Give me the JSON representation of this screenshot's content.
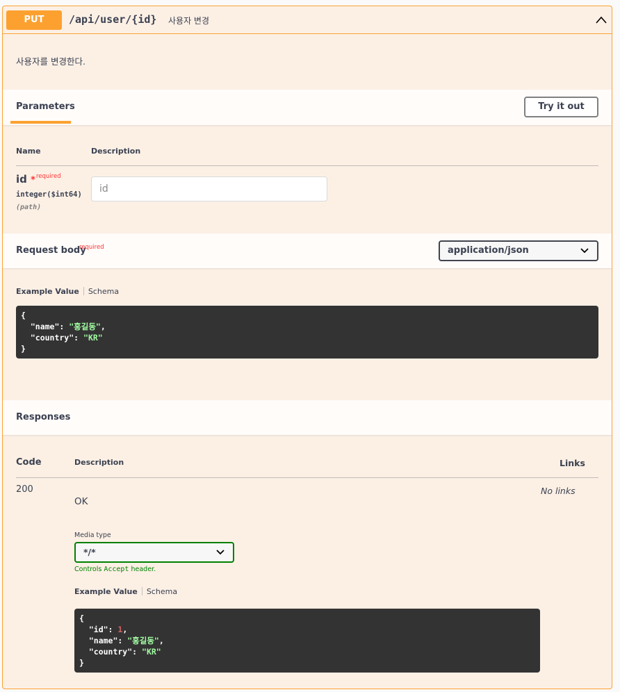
{
  "operation": {
    "method": "PUT",
    "path": "/api/user/{id}",
    "summary": "사용자 변경",
    "description": "사용자를 변경한다."
  },
  "parameters": {
    "title": "Parameters",
    "try_button": "Try it out",
    "col_name": "Name",
    "col_description": "Description",
    "items": [
      {
        "name": "id",
        "required_star": "*",
        "required_label": "required",
        "type": "integer($int64)",
        "in": "(path)",
        "placeholder": "id"
      }
    ]
  },
  "request_body": {
    "title": "Request body",
    "required_label": "required",
    "content_type": "application/json",
    "example_tab": "Example Value",
    "schema_tab": "Schema",
    "example_lines": [
      "{",
      "  \"name\": \"홍길동\",",
      "  \"country\": \"KR\"",
      "}"
    ]
  },
  "responses": {
    "title": "Responses",
    "col_code": "Code",
    "col_description": "Description",
    "col_links": "Links",
    "items": [
      {
        "code": "200",
        "description": "OK",
        "links": "No links",
        "media_type_label": "Media type",
        "media_type": "*/*",
        "controls_prefix": "Controls",
        "controls_code": "Accept",
        "controls_suffix": "header.",
        "example_tab": "Example Value",
        "schema_tab": "Schema",
        "example_lines": [
          "{",
          "  \"id\": 1,",
          "  \"name\": \"홍길동\",",
          "  \"country\": \"KR\"",
          "}"
        ]
      }
    ]
  },
  "colors": {
    "put_accent": "#fca130",
    "put_background": "#fcf0e5",
    "code_background": "#333333",
    "string_color": "#a2fca2",
    "number_color": "#d36363",
    "required_color": "#ff3333",
    "controls_color": "#008000"
  },
  "icons": {
    "collapse": "chevron-up-icon",
    "select": "chevron-down-icon"
  }
}
